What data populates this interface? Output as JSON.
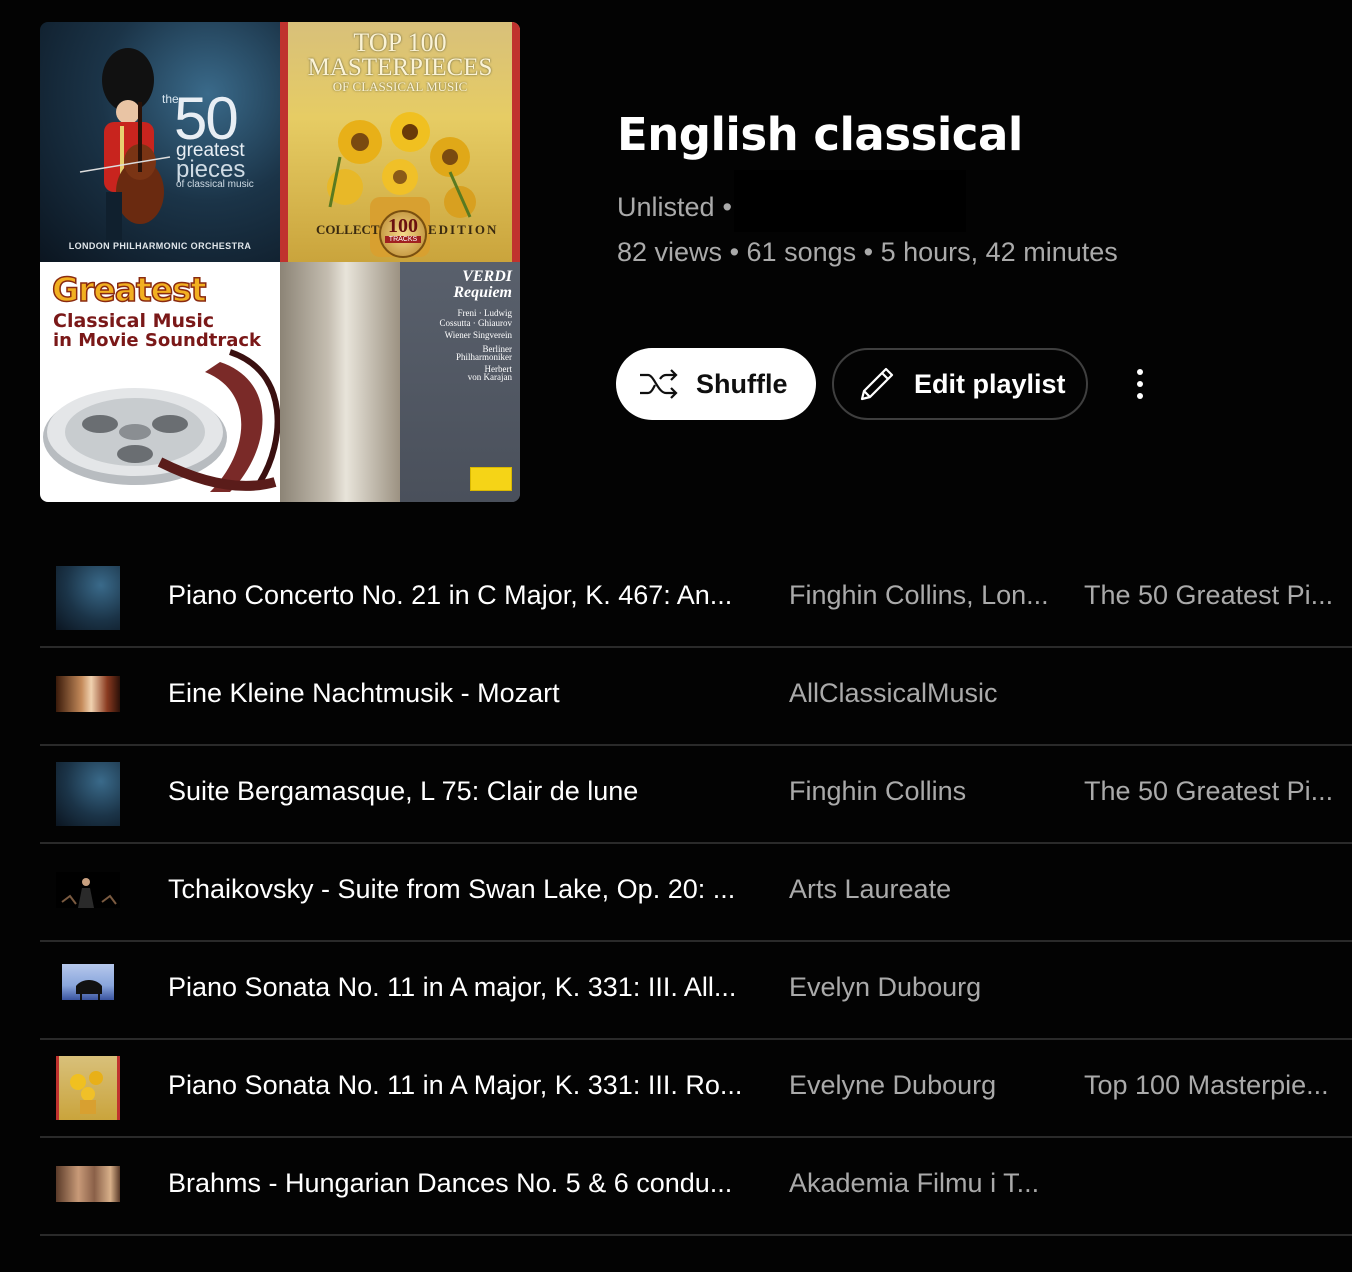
{
  "playlist": {
    "title": "English classical",
    "visibility": "Unlisted",
    "separator": "•",
    "views": "82 views",
    "songs": "61 songs",
    "duration": "5 hours, 42 minutes"
  },
  "covers": {
    "c1": {
      "the": "the",
      "fifty": "50",
      "greatest": "greatest",
      "pieces": "pieces",
      "of_classical": "of classical music",
      "orchestra": "LONDON PHILHARMONIC ORCHESTRA"
    },
    "c2": {
      "line1": "TOP 100",
      "line2": "MASTERPIECES",
      "line3": "OF CLASSICAL MUSIC",
      "collectors": "COLLECTORS",
      "edition": "EDITION",
      "medal_number": "100",
      "medal_label": "TRACKS"
    },
    "c3": {
      "line1": "Greatest",
      "line2": "Classical Music",
      "line3": "in Movie Soundtrack"
    },
    "c4": {
      "line1": "VERDI",
      "line2": "Requiem",
      "soloists1": "Freni · Ludwig",
      "soloists2": "Cossutta · Ghiaurov",
      "choir": "Wiener Singverein",
      "orch1": "Berliner",
      "orch2": "Philharmoniker",
      "cond1": "Herbert",
      "cond2": "von Karajan"
    }
  },
  "actions": {
    "shuffle_label": "Shuffle",
    "edit_label": "Edit playlist"
  },
  "tracks": [
    {
      "title": "Piano Concerto No. 21 in C Major, K. 467: An...",
      "artist": "Finghin Collins, Lon...",
      "album": "The 50 Greatest Pi...",
      "thumb": "50-greatest-pieces"
    },
    {
      "title": "Eine Kleine Nachtmusik - Mozart",
      "artist": "AllClassicalMusic",
      "album": "",
      "thumb": "mozart-portrait"
    },
    {
      "title": "Suite Bergamasque, L 75: Clair de lune",
      "artist": "Finghin Collins",
      "album": "The 50 Greatest Pi...",
      "thumb": "50-greatest-pieces"
    },
    {
      "title": "Tchaikovsky - Suite from Swan Lake, Op. 20: ...",
      "artist": "Arts Laureate",
      "album": "",
      "thumb": "conductor"
    },
    {
      "title": "Piano Sonata No. 11 in A major, K. 331: III. All...",
      "artist": "Evelyn Dubourg",
      "album": "",
      "thumb": "piano"
    },
    {
      "title": "Piano Sonata No. 11 in A Major, K. 331: III. Ro...",
      "artist": "Evelyne Dubourg",
      "album": "Top 100 Masterpie...",
      "thumb": "top-100-masterpieces"
    },
    {
      "title": "Brahms - Hungarian Dances No. 5 & 6 condu...",
      "artist": "Akademia Filmu i T...",
      "album": "",
      "thumb": "orchestra-musicians"
    }
  ]
}
